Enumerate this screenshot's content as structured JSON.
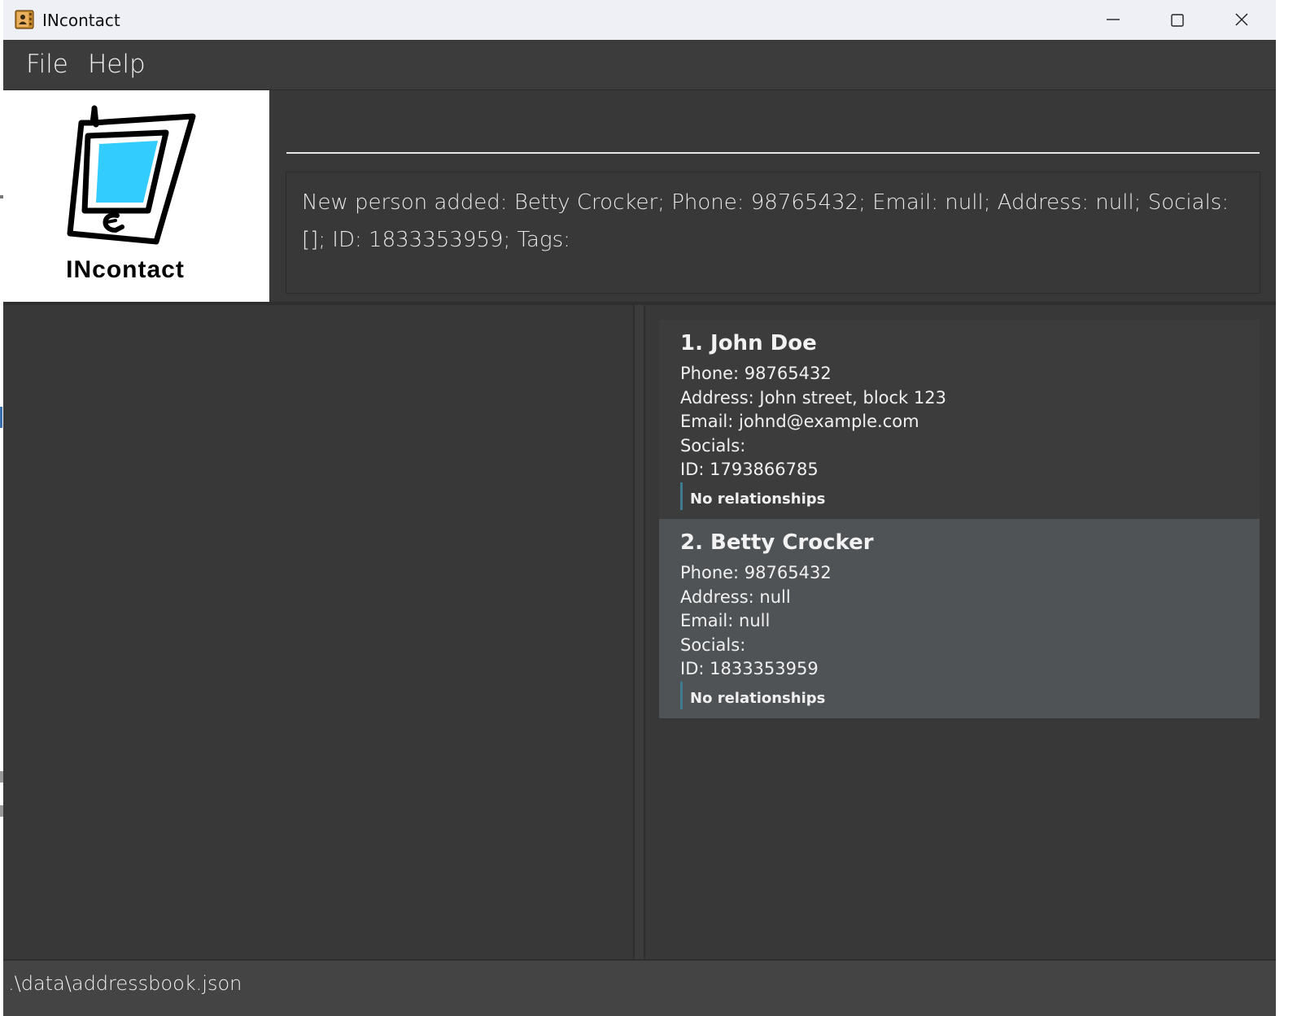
{
  "window": {
    "title": "INcontact",
    "icons": [
      "app-icon",
      "minimize-icon",
      "maximize-icon",
      "close-icon"
    ]
  },
  "menubar": {
    "file_label": "File",
    "help_label": "Help"
  },
  "logo": {
    "text": "INcontact",
    "screen_color": "#33ccff"
  },
  "command": {
    "value": "",
    "placeholder": ""
  },
  "result": {
    "message": "New person added: Betty Crocker; Phone: 98765432; Email: null; Address: null; Socials: []; ID: 1833353959; Tags:"
  },
  "persons": [
    {
      "name": "1. John Doe",
      "phone": "Phone: 98765432",
      "address": "Address: John street, block 123",
      "email": "Email: johnd@example.com",
      "socials": "Socials:",
      "id": "ID: 1793866785",
      "relationships": "No relationships"
    },
    {
      "name": "2. Betty Crocker",
      "phone": "Phone: 98765432",
      "address": "Address: null",
      "email": "Email: null",
      "socials": "Socials:",
      "id": "ID: 1833353959",
      "relationships": "No relationships"
    }
  ],
  "statusbar": {
    "path": ".\\data\\addressbook.json"
  },
  "colors": {
    "background": "#383838",
    "selected_card": "#4f5356",
    "relationship_accent": "#3e7b91"
  }
}
